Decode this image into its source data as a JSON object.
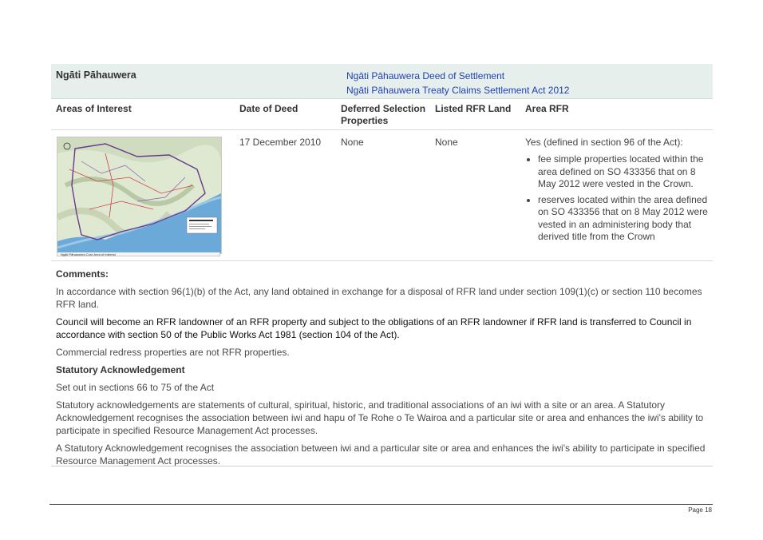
{
  "banner": {
    "iwi_name": "Ngāti Pāhauwera",
    "deed_link": "Ngāti Pāhauwera Deed of Settlement",
    "act_link": "Ngāti Pāhauwera Treaty Claims Settlement Act 2012"
  },
  "columns": {
    "areas": "Areas of Interest",
    "date": "Date of Deed",
    "deferred_line1": "Deferred Selection",
    "deferred_line2": "Properties",
    "listed": "Listed RFR Land",
    "area_rfr": "Area RFR"
  },
  "row": {
    "map_caption": "Ngāti Pāhauwera Core Area of Interest",
    "date": "17 December 2010",
    "deferred": "None",
    "listed": "None",
    "area_rfr_intro": "Yes (defined in section 96 of the Act):",
    "bullets": [
      "fee simple properties located within the area defined on SO 433356 that on 8 May 2012 were vested in the Crown.",
      "reserves located within the area defined on SO 433356 that on 8 May 2012 were vested in an administering body that derived title from the Crown"
    ]
  },
  "comments": {
    "heading": "Comments:",
    "p1": "In accordance with section 96(1)(b) of the Act, any land obtained in exchange for a disposal of RFR land under section 109(1)(c) or section 110 becomes RFR land.",
    "p2": "Council will become an RFR landowner of an RFR property and subject to the obligations of an RFR landowner if RFR land is transferred to Council in accordance with section 50 of the Public Works Act 1981 (section 104 of the Act).",
    "p3": "Commercial redress properties are not RFR properties.",
    "sa_heading": "Statutory Acknowledgement",
    "sa_p1": "Set out in sections 66 to 75 of the Act",
    "sa_p2": "Statutory acknowledgements are statements of cultural, spiritual, historic, and traditional associations of an iwi with a site or an area. A Statutory Acknowledgement recognises the association between iwi and hapu of Te Rohe o Te Wairoa and a particular site or area and enhances the iwi's ability to participate in specified Resource Management Act processes.",
    "sa_p3": "A Statutory Acknowledgement recognises the association between iwi and a particular site or area and enhances the iwi's ability to participate in specified Resource Management Act processes."
  },
  "footer": {
    "page": "Page 18"
  }
}
